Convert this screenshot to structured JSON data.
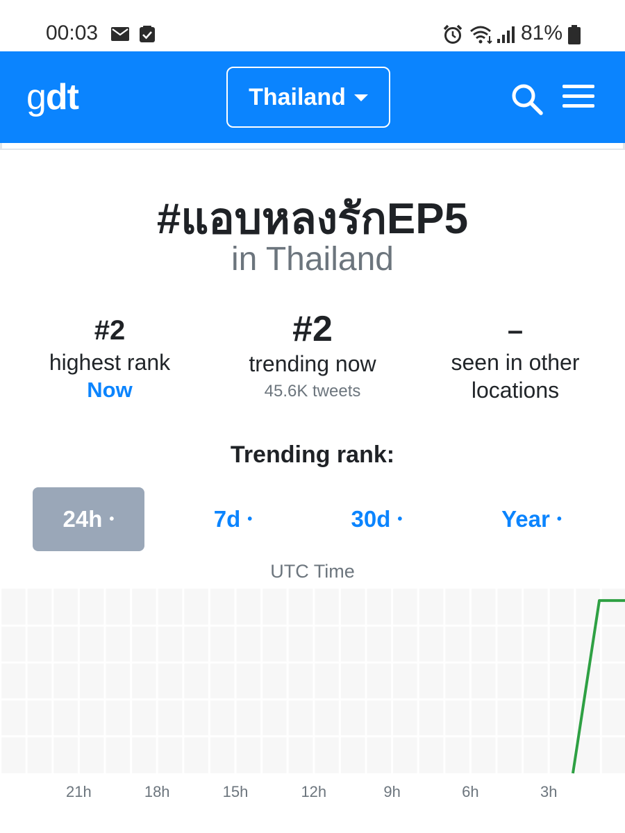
{
  "status_bar": {
    "time": "00:03",
    "battery": "81%",
    "icons": [
      "mail-icon",
      "checkbox-icon",
      "alarm-icon",
      "wifi-icon",
      "signal-icon",
      "battery-icon"
    ]
  },
  "navbar": {
    "logo_g": "g",
    "logo_dt": "dt",
    "country": "Thailand",
    "icons": [
      "caret-down-icon",
      "search-icon",
      "hamburger-menu-icon"
    ],
    "color": "#0b84fe"
  },
  "trend": {
    "hashtag": "#แอบหลงรักEP5",
    "location": "in Thailand"
  },
  "stats": {
    "highest": {
      "value": "#2",
      "label": "highest rank",
      "note": "Now"
    },
    "trending": {
      "value": "#2",
      "label": "trending now",
      "sub": "45.6K tweets"
    },
    "other": {
      "value": "–",
      "label_line1": "seen in other",
      "label_line2": "locations"
    }
  },
  "chart_section": {
    "title": "Trending rank:",
    "tabs": [
      {
        "label": "24h",
        "active": true
      },
      {
        "label": "7d",
        "active": false
      },
      {
        "label": "30d",
        "active": false
      },
      {
        "label": "Year",
        "active": false
      }
    ],
    "tab_dot": "•",
    "active_tab_color": "#9aa7b8"
  },
  "chart_data": {
    "type": "line",
    "xlabel": "UTC Time",
    "x_tick_labels": [
      "21h",
      "18h",
      "15h",
      "12h",
      "9h",
      "6h",
      "3h"
    ],
    "x_axis_direction": "hours ago, decreasing left to right",
    "grid": true,
    "series": [
      {
        "color": "#2ea043",
        "points": [
          {
            "x_hours_ago": 2.0,
            "rank": 50
          },
          {
            "x_hours_ago": 1.0,
            "rank": 2
          },
          {
            "x_hours_ago": 0.0,
            "rank": 2
          }
        ]
      }
    ],
    "ylim": [
      1,
      50
    ],
    "y_inverted": true
  }
}
